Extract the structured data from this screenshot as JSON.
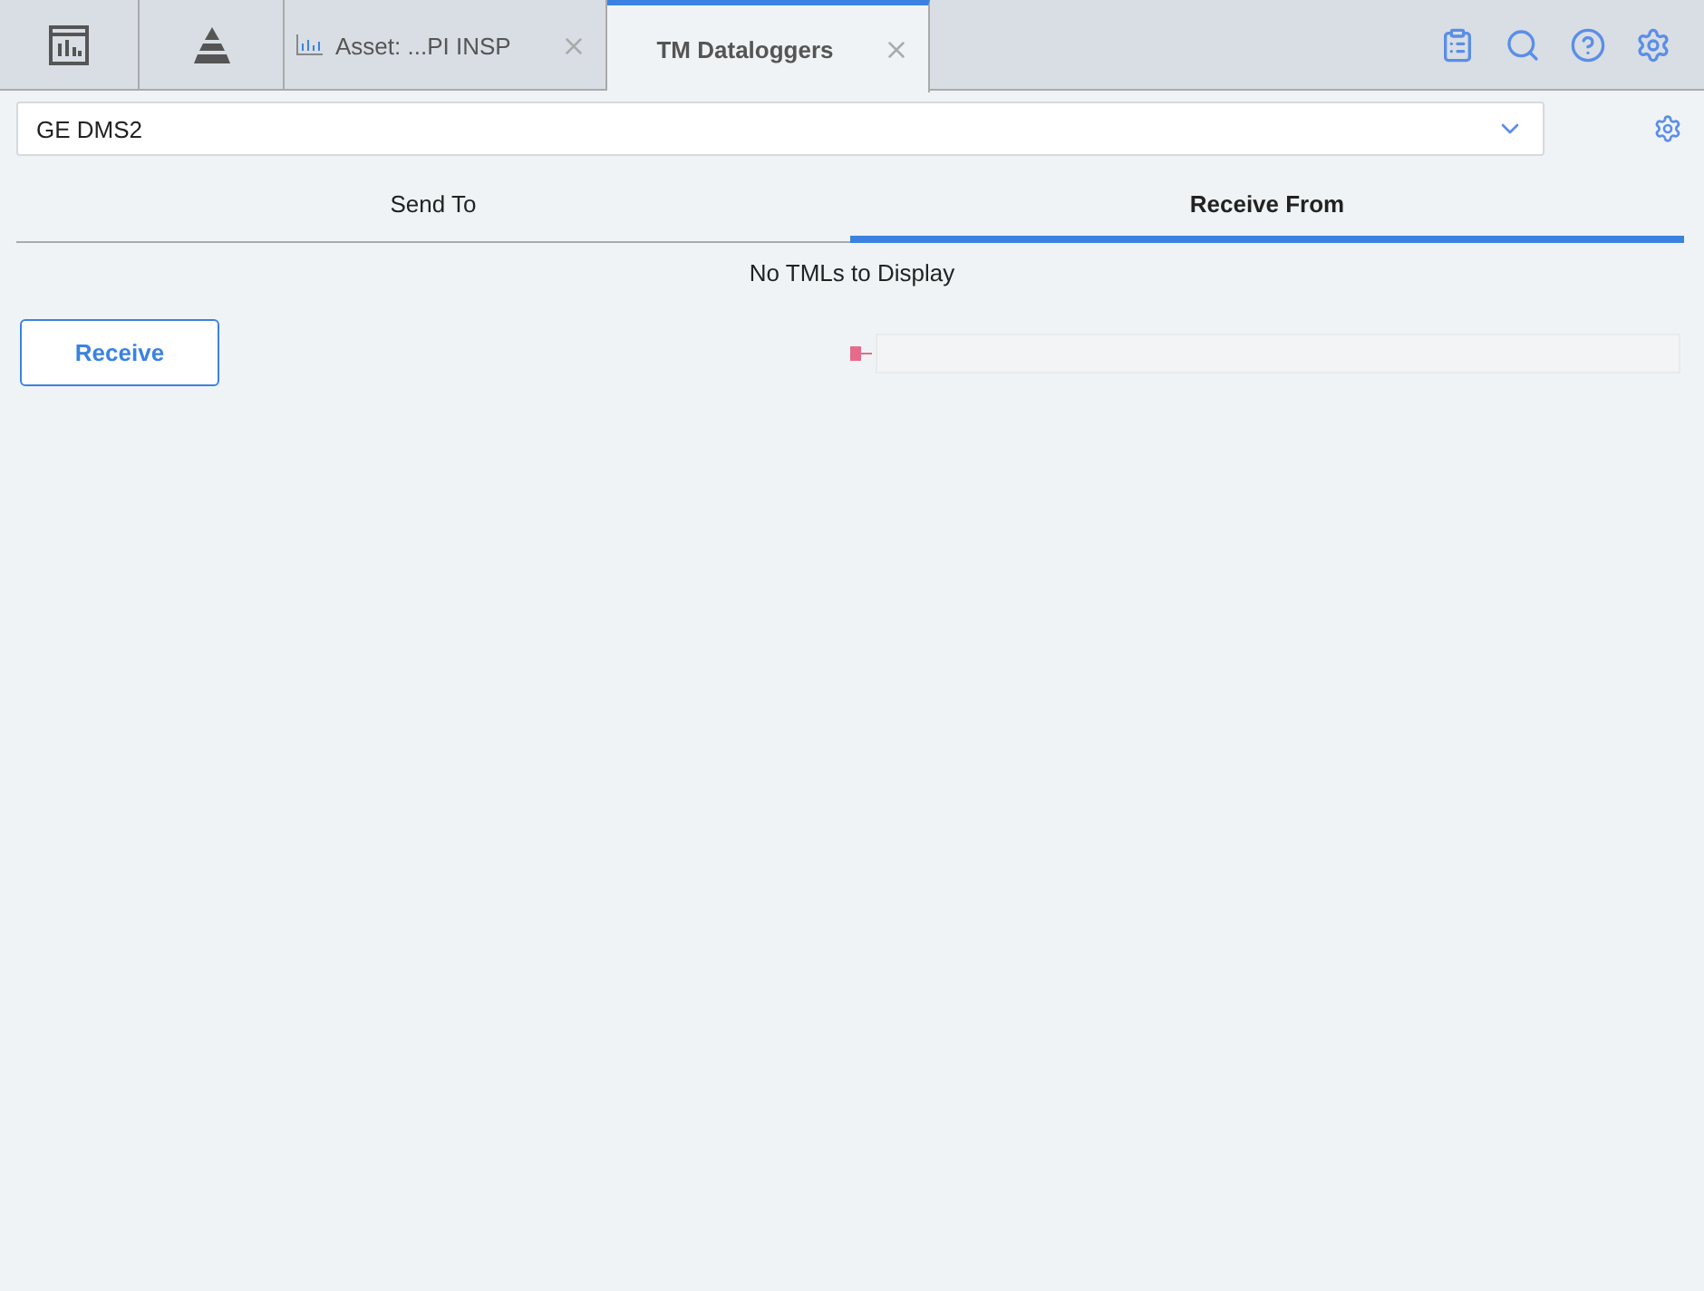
{
  "app_tabs": [
    {
      "kind": "icon",
      "selected": false
    },
    {
      "kind": "icon",
      "selected": false
    },
    {
      "kind": "doc",
      "label": "Asset: ...PI INSP",
      "selected": false
    },
    {
      "kind": "doc",
      "label": "TM Dataloggers",
      "selected": true
    }
  ],
  "datalogger": {
    "value": "GE DMS2"
  },
  "sub_tabs": [
    {
      "label": "Send To",
      "selected": false
    },
    {
      "label": "Receive From",
      "selected": true
    }
  ],
  "message": "No TMLs to Display",
  "receive_button": "Receive"
}
